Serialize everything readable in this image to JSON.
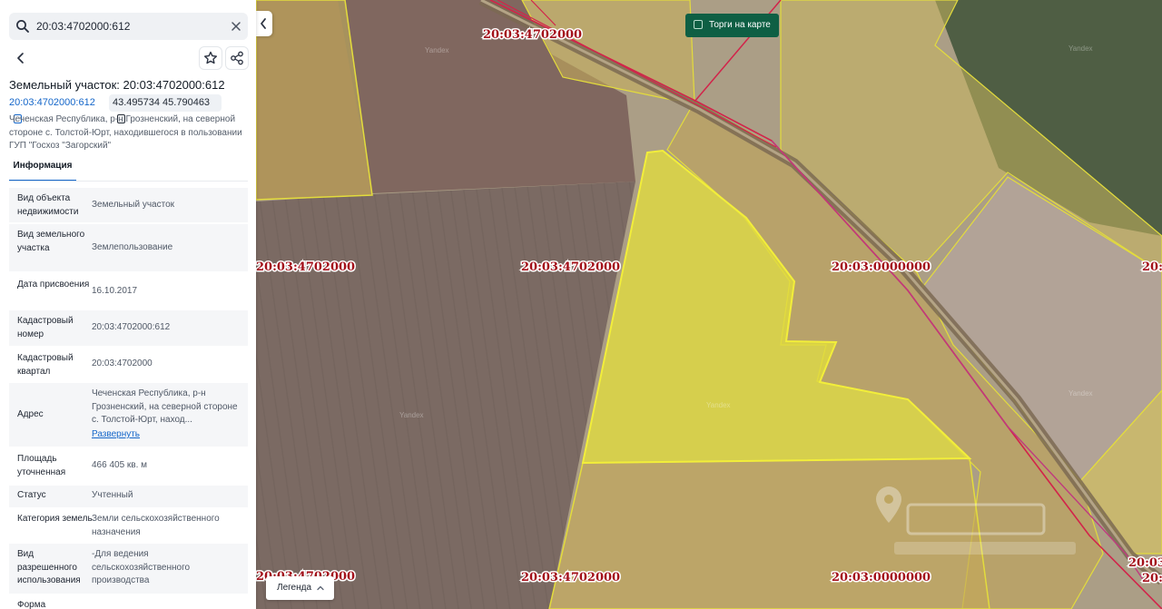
{
  "search": {
    "value": "20:03:4702000:612",
    "icon": "search-icon",
    "clear_icon": "close-icon"
  },
  "header": {
    "back_icon": "chevron-left-icon",
    "favorite_icon": "star-icon",
    "share_icon": "share-icon"
  },
  "parcel": {
    "title": "Земельный участок: 20:03:4702000:612",
    "cadastral_chip": "20:03:4702000:612",
    "coords_chip": "43.495734 45.790463",
    "address_short": "Чеченская Республика, р-н Грозненский, на северной стороне с. Толстой-Юрт, находившегося в пользовании ГУП \"Госхоз \"Загорский\""
  },
  "tabs": [
    {
      "label": "Информация",
      "active": true
    }
  ],
  "info_rows": [
    {
      "label": "Вид объекта недвижимости",
      "value": "Земельный участок"
    },
    {
      "label": "Вид земельного участка",
      "value": "Землепользование"
    },
    {
      "label": "Дата присвоения",
      "value": "16.10.2017"
    },
    {
      "label": "Кадастровый номер",
      "value": "20:03:4702000:612"
    },
    {
      "label": "Кадастровый квартал",
      "value": "20:03:4702000"
    },
    {
      "label": "Адрес",
      "value": "Чеченская Республика, р-н Грозненский, на северной стороне с. Толстой-Юрт, наход...",
      "link": "Развернуть"
    },
    {
      "label": "Площадь уточненная",
      "value": "466 405 кв. м"
    },
    {
      "label": "Статус",
      "value": "Учтенный"
    },
    {
      "label": "Категория земель",
      "value": "Земли сельскохозяйственного назначения"
    },
    {
      "label": "Вид разрешенного использования",
      "value": "-Для ведения сельскохозяйственного производства"
    },
    {
      "label": "Форма",
      "value": ""
    }
  ],
  "map": {
    "auction_toggle": "Торги на карте",
    "legend": "Легенда",
    "collapse_icon": "chevron-left-icon",
    "legend_icon": "chevron-up-icon",
    "labels": [
      "20:03:4702000",
      "20:03:4702000",
      "20:03:4702000",
      "20:03:0000000",
      "20:03:4702000",
      "20:03:4702000",
      "20:03:0000000",
      "20:03:",
      "20:03:",
      "20:03:"
    ],
    "watermarks": [
      "Yandex",
      "Yandex",
      "Yandex",
      "Yandex",
      "Yandex"
    ],
    "colors": {
      "selected_parcel": "#d9d235",
      "parcel_fill": "#cdb64e",
      "parcel_border": "#e7e23c",
      "boundary_red": "#d2244a",
      "label_text": "#a3101a"
    }
  }
}
